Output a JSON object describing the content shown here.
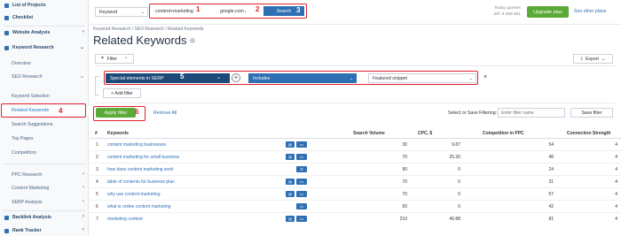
{
  "sidebar": {
    "items": [
      {
        "label": "List of Projects"
      },
      {
        "label": "Checklist"
      },
      {
        "label": "Website Analysis"
      },
      {
        "label": "Keyword Research"
      },
      {
        "label": "Overview"
      },
      {
        "label": "SEO Research"
      },
      {
        "label": "Keyword Selection"
      },
      {
        "label": "Related Keywords"
      },
      {
        "label": "Search Suggestions"
      },
      {
        "label": "Top Pages"
      },
      {
        "label": "Competitors"
      },
      {
        "label": "PPC Research"
      },
      {
        "label": "Content Marketing"
      },
      {
        "label": "SERP Analysis"
      },
      {
        "label": "Backlink Analysis"
      },
      {
        "label": "Rank Tracker"
      }
    ]
  },
  "annotations": {
    "n1": "1",
    "n2": "2",
    "n3": "3",
    "n4": "4",
    "n5": "5",
    "n6": "6"
  },
  "topbar": {
    "mode": "Keyword",
    "query": "content+marketing",
    "engine": "google.com",
    "search_label": "Search",
    "quota_line1": "Today queries",
    "quota_line2": "left: 9 999 901",
    "upgrade_label": "Upgrade plan",
    "other_plans": "See other plans"
  },
  "breadcrumb": "Keyword Research / SEO Research / Related Keywords",
  "page_title": "Related Keywords",
  "toolbar": {
    "filter_label": "Filter",
    "export_label": "Export"
  },
  "filter": {
    "field": "Special elements in SERP",
    "operator": "Includes",
    "value": "Featured snippet",
    "add_filter": "+ Add filter",
    "apply": "Apply filter",
    "remove_all": "Remove All",
    "select_label": "Select or Save Filtering:",
    "name_placeholder": "Enter filter name",
    "save_label": "Save filter"
  },
  "table": {
    "headers": {
      "num": "#",
      "keywords": "Keywords",
      "volume": "Search Volume",
      "cpc": "CPC, $",
      "competition": "Competition in PPC",
      "strength": "Connection Strength"
    },
    "rows": [
      {
        "n": "1",
        "kw": "content marketing businesses",
        "vol": "30",
        "cpc": "9.87",
        "comp": "54",
        "str": "4"
      },
      {
        "n": "2",
        "kw": "content marketing for small business",
        "vol": "70",
        "cpc": "25.30",
        "comp": "48",
        "str": "4"
      },
      {
        "n": "3",
        "kw": "how does content marketing work",
        "vol": "90",
        "cpc": "0",
        "comp": "24",
        "str": "4"
      },
      {
        "n": "4",
        "kw": "table of contents for business plan",
        "vol": "70",
        "cpc": "0",
        "comp": "31",
        "str": "4"
      },
      {
        "n": "5",
        "kw": "why use content marketing",
        "vol": "70",
        "cpc": "0",
        "comp": "57",
        "str": "4"
      },
      {
        "n": "6",
        "kw": "what is online content marketing",
        "vol": "50",
        "cpc": "0",
        "comp": "42",
        "str": "4"
      },
      {
        "n": "7",
        "kw": "marketing content",
        "vol": "210",
        "cpc": "40.88",
        "comp": "81",
        "str": "4"
      }
    ]
  },
  "colors": {
    "accent": "#2f6fb3",
    "annotation": "#e0222a",
    "green": "#5aaa37",
    "dark_field": "#1e4a7a"
  }
}
